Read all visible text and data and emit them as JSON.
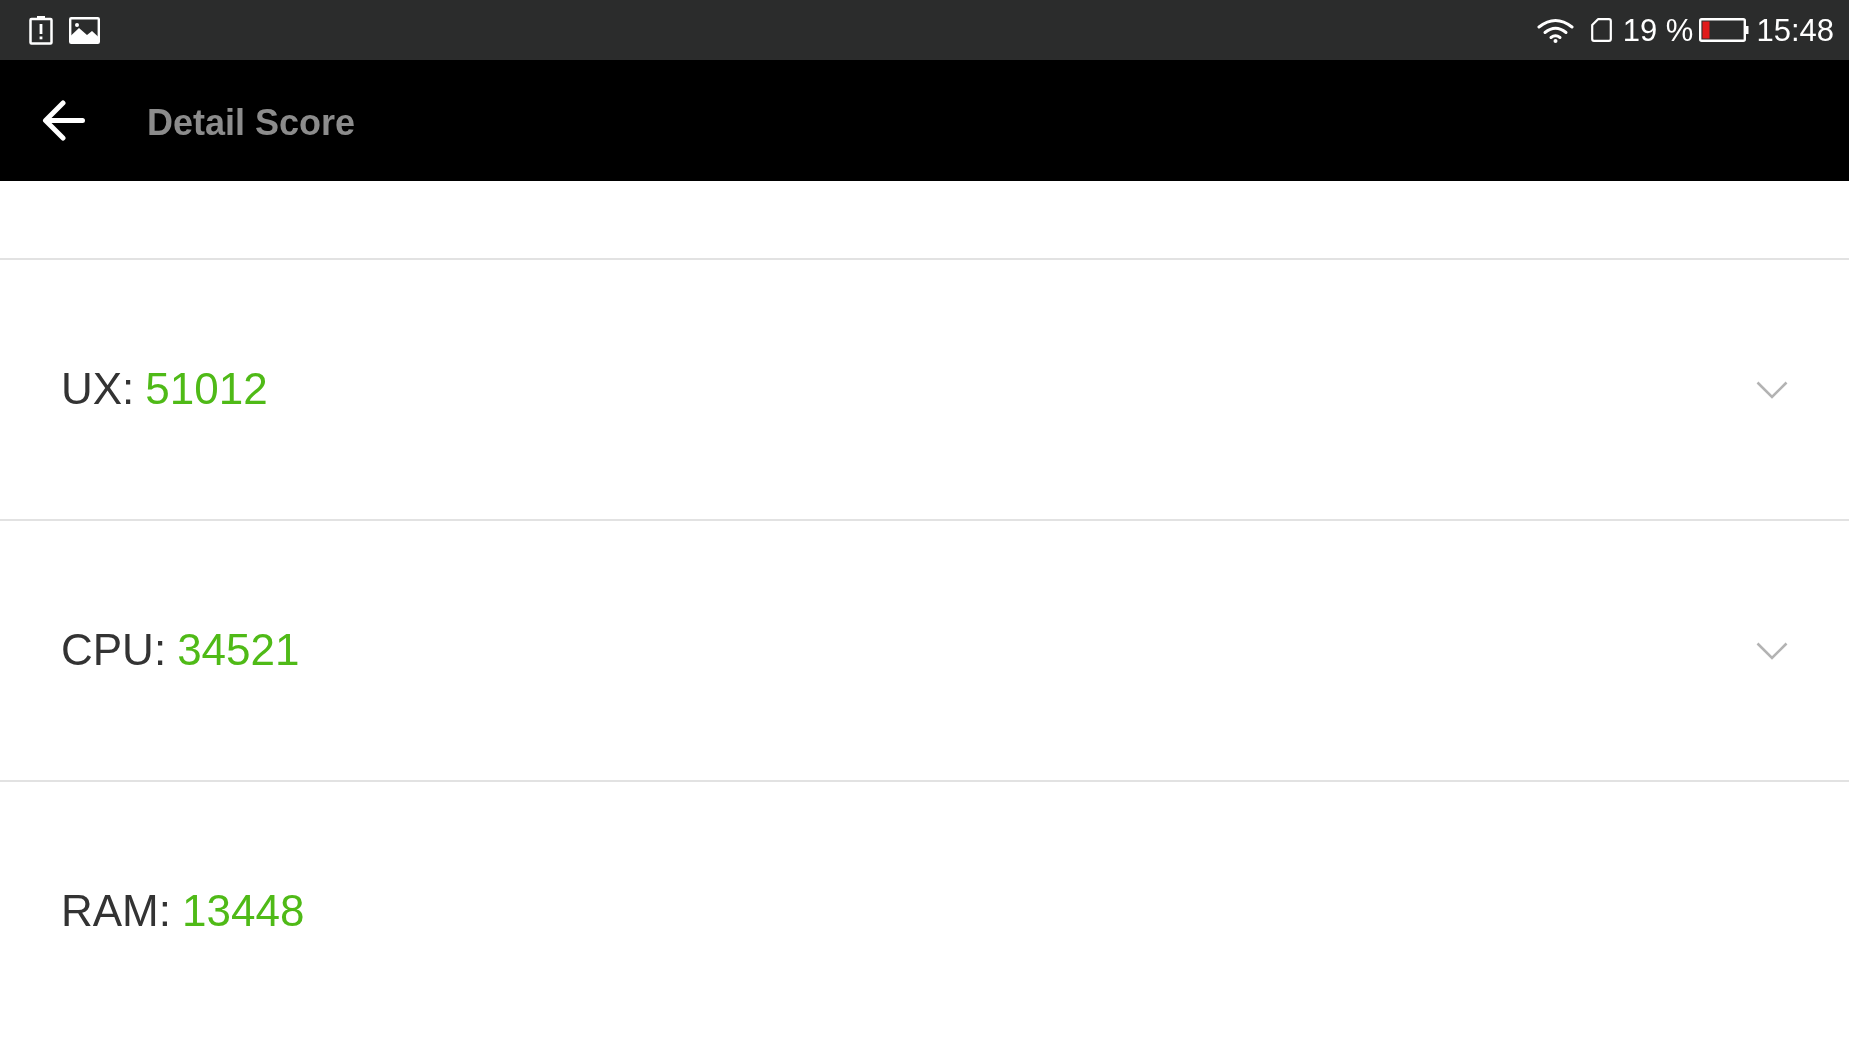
{
  "status_bar": {
    "battery_percent": "19 %",
    "time": "15:48"
  },
  "app_bar": {
    "title": "Detail Score"
  },
  "scores": [
    {
      "label": "UX:",
      "value": "51012",
      "expandable": true
    },
    {
      "label": "CPU:",
      "value": "34521",
      "expandable": true
    },
    {
      "label": "RAM:",
      "value": "13448",
      "expandable": false
    }
  ]
}
